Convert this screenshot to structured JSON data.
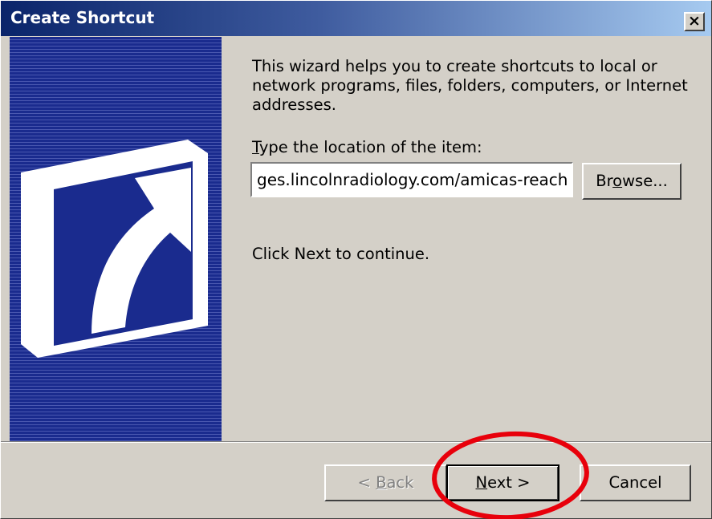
{
  "window": {
    "title": "Create Shortcut",
    "close_icon": "close-icon",
    "close_glyph": "×"
  },
  "banner": {
    "icon": "shortcut-arrow-icon"
  },
  "content": {
    "intro": "This wizard helps you to create shortcuts to local or network programs, files, folders, computers, or Internet addresses.",
    "field_label_accel": "T",
    "field_label_rest": "ype the location of the item:",
    "location_value": "ges.lincolnradiology.com/amicas-reach/",
    "browse_pre": "Br",
    "browse_accel": "o",
    "browse_post": "wse...",
    "continue_text": "Click Next to continue."
  },
  "buttons": {
    "back_pre": "< ",
    "back_accel": "B",
    "back_post": "ack",
    "next_accel": "N",
    "next_post": "ext >",
    "cancel": "Cancel"
  },
  "annotation": {
    "shape": "ellipse",
    "target": "next-button",
    "color": "#e8000b"
  }
}
